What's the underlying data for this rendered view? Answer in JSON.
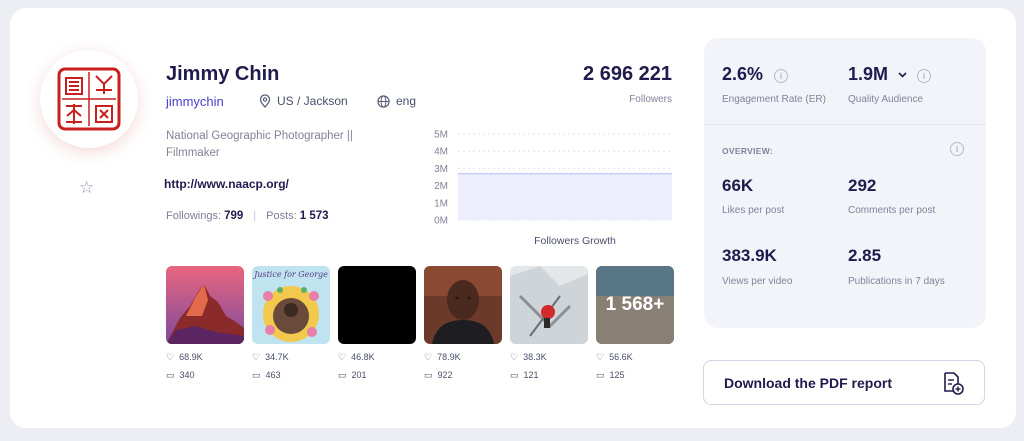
{
  "profile": {
    "name": "Jimmy Chin",
    "handle": "jimmychin",
    "location": "US / Jackson",
    "language": "eng",
    "bio": "National Geographic Photographer || Filmmaker",
    "website": "http://www.naacp.org/",
    "followings_label": "Followings:",
    "followings": "799",
    "posts_label": "Posts:",
    "posts": "1 573"
  },
  "followers": {
    "count": "2 696 221",
    "label": "Followers"
  },
  "chart_data": {
    "type": "area",
    "title": "Followers Growth",
    "y_ticks": [
      "5M",
      "4M",
      "3M",
      "2M",
      "1M",
      "0M"
    ],
    "ylim": [
      0,
      5000000
    ],
    "values": [
      2696221,
      2696221
    ],
    "fill_color": "#eceefc",
    "line_color": "#c9cef5"
  },
  "posts_grid": [
    {
      "likes": "68.9K",
      "comments": "340"
    },
    {
      "likes": "34.7K",
      "comments": "463",
      "caption": "Justice for George"
    },
    {
      "likes": "46.8K",
      "comments": "201"
    },
    {
      "likes": "78.9K",
      "comments": "922"
    },
    {
      "likes": "38.3K",
      "comments": "121"
    },
    {
      "likes": "56.6K",
      "comments": "125",
      "overlay": "1 568+"
    }
  ],
  "metrics": {
    "er_value": "2.6%",
    "er_label": "Engagement Rate (ER)",
    "qa_value": "1.9M",
    "qa_label": "Quality Audience",
    "overview_label": "OVERVIEW:",
    "likes_value": "66K",
    "likes_label": "Likes per post",
    "comments_value": "292",
    "comments_label": "Comments per post",
    "views_value": "383.9K",
    "views_label": "Views per video",
    "pubs_value": "2.85",
    "pubs_label": "Publications in 7 days"
  },
  "pdf_button": {
    "label": "Download the PDF report"
  },
  "colors": {
    "accent": "#4a3fd0",
    "text_dark": "#1f1b4d",
    "seal_red": "#c8201e"
  }
}
